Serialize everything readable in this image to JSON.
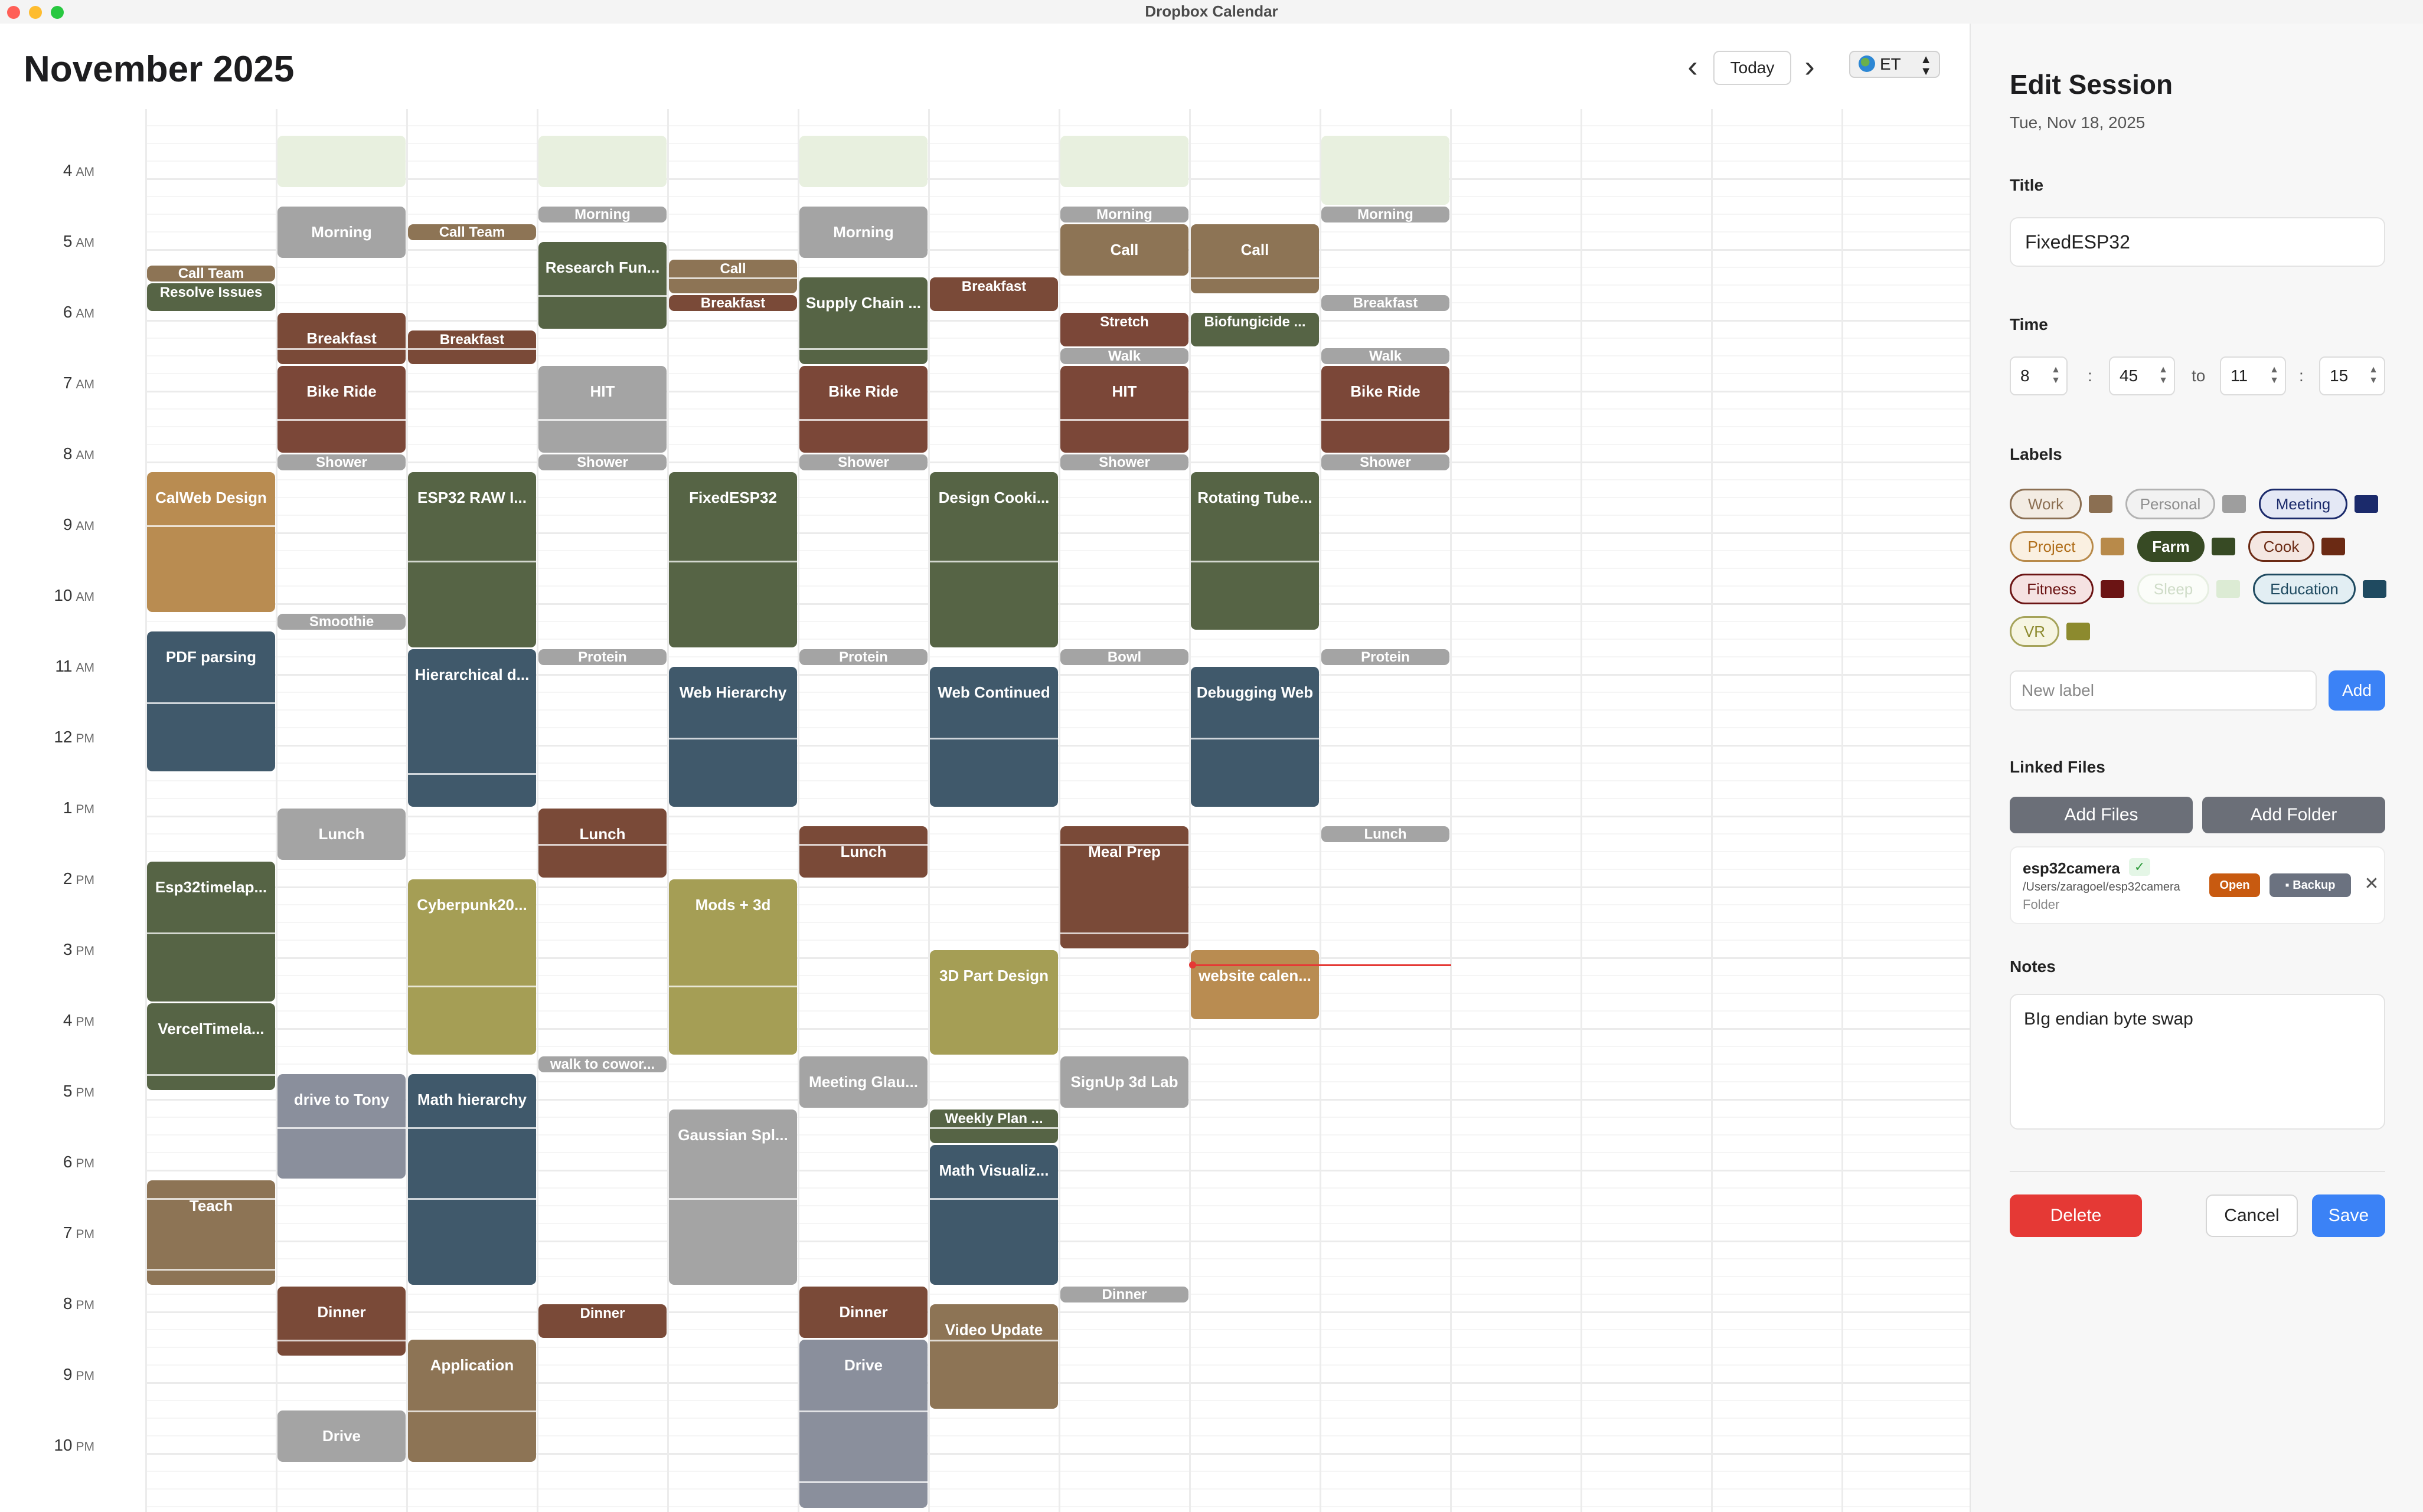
{
  "window": {
    "title": "Dropbox Calendar"
  },
  "header": {
    "month": "November 2025",
    "prev_glyph": "‹",
    "today_label": "Today",
    "next_glyph": "›",
    "timezone": "ET"
  },
  "hours": [
    {
      "h": "4",
      "ampm": "AM"
    },
    {
      "h": "5",
      "ampm": "AM"
    },
    {
      "h": "6",
      "ampm": "AM"
    },
    {
      "h": "7",
      "ampm": "AM"
    },
    {
      "h": "8",
      "ampm": "AM"
    },
    {
      "h": "9",
      "ampm": "AM"
    },
    {
      "h": "10",
      "ampm": "AM"
    },
    {
      "h": "11",
      "ampm": "AM"
    },
    {
      "h": "12",
      "ampm": "PM"
    },
    {
      "h": "1",
      "ampm": "PM"
    },
    {
      "h": "2",
      "ampm": "PM"
    },
    {
      "h": "3",
      "ampm": "PM"
    },
    {
      "h": "4",
      "ampm": "PM"
    },
    {
      "h": "5",
      "ampm": "PM"
    },
    {
      "h": "6",
      "ampm": "PM"
    },
    {
      "h": "7",
      "ampm": "PM"
    },
    {
      "h": "8",
      "ampm": "PM"
    },
    {
      "h": "9",
      "ampm": "PM"
    },
    {
      "h": "10",
      "ampm": "PM"
    }
  ],
  "label_colors": {
    "Work": "#8b6f52",
    "Personal": "#9e9e9e",
    "Meeting": "#1b2a6b",
    "Project": "#b88a4a",
    "Farm": "#374a24",
    "Cook": "#6b2a14",
    "Fitness": "#6b1414",
    "Sleep": "#dcebd4",
    "Education": "#1f4a60",
    "VR": "#8c8a2e"
  },
  "event_colors": {
    "personal": "#a4a4a4",
    "work": "#8d7455",
    "farm": "#566445",
    "cook": "#7a4a38",
    "fitness": "#7b4738",
    "education": "#40596b",
    "project": "#b98c51",
    "vr": "#a59e55",
    "sleep": "#e8f0df",
    "slate": "#8a8f9c"
  },
  "events": [
    {
      "day": 0,
      "start": 5.333,
      "end": 5.583,
      "title": "Call Team",
      "color": "work",
      "segs": []
    },
    {
      "day": 0,
      "start": 5.583,
      "end": 6.0,
      "title": "Resolve Issues",
      "color": "farm",
      "segs": []
    },
    {
      "day": 0,
      "start": 8.25,
      "end": 10.25,
      "title": "CalWeb Design",
      "color": "project",
      "segs": [
        9.0
      ]
    },
    {
      "day": 0,
      "start": 10.5,
      "end": 12.5,
      "title": "PDF parsing",
      "color": "education",
      "segs": [
        11.5
      ]
    },
    {
      "day": 0,
      "start": 13.75,
      "end": 15.75,
      "title": "Esp32timelap...",
      "color": "farm",
      "segs": [
        14.75
      ]
    },
    {
      "day": 0,
      "start": 15.75,
      "end": 17.0,
      "title": "VercelTimela...",
      "color": "farm",
      "segs": [
        16.75
      ]
    },
    {
      "day": 0,
      "start": 18.25,
      "end": 19.75,
      "title": "Teach",
      "color": "work",
      "segs": [
        18.5,
        19.5
      ]
    },
    {
      "day": 1,
      "start": 3.5,
      "end": 4.25,
      "title": "",
      "color": "sleep",
      "segs": []
    },
    {
      "day": 1,
      "start": 4.5,
      "end": 5.25,
      "title": "Morning",
      "color": "personal",
      "segs": []
    },
    {
      "day": 1,
      "start": 6.0,
      "end": 6.75,
      "title": "Breakfast",
      "color": "cook",
      "segs": [
        6.5
      ]
    },
    {
      "day": 1,
      "start": 6.75,
      "end": 8.0,
      "title": "Bike Ride",
      "color": "fitness",
      "segs": [
        7.5
      ]
    },
    {
      "day": 1,
      "start": 8.0,
      "end": 8.25,
      "title": "Shower",
      "color": "personal",
      "segs": []
    },
    {
      "day": 1,
      "start": 10.25,
      "end": 10.5,
      "title": "Smoothie",
      "color": "personal",
      "segs": []
    },
    {
      "day": 1,
      "start": 13.0,
      "end": 13.75,
      "title": "Lunch",
      "color": "personal",
      "segs": []
    },
    {
      "day": 1,
      "start": 16.75,
      "end": 18.25,
      "title": "drive to Tony",
      "color": "slate",
      "segs": [
        17.5
      ]
    },
    {
      "day": 1,
      "start": 19.75,
      "end": 20.75,
      "title": "Dinner",
      "color": "cook",
      "segs": [
        20.5
      ]
    },
    {
      "day": 1,
      "start": 21.5,
      "end": 22.25,
      "title": "Drive",
      "color": "personal",
      "segs": []
    },
    {
      "day": 2,
      "start": 4.75,
      "end": 5.0,
      "title": "Call Team",
      "color": "work",
      "segs": []
    },
    {
      "day": 2,
      "start": 6.25,
      "end": 6.75,
      "title": "Breakfast",
      "color": "cook",
      "segs": [
        6.5
      ]
    },
    {
      "day": 2,
      "start": 8.25,
      "end": 10.75,
      "title": "ESP32 RAW I...",
      "color": "farm",
      "segs": [
        9.5
      ]
    },
    {
      "day": 2,
      "start": 10.75,
      "end": 13.0,
      "title": "Hierarchical d...",
      "color": "education",
      "segs": [
        12.5
      ]
    },
    {
      "day": 2,
      "start": 14.0,
      "end": 16.5,
      "title": "Cyberpunk20...",
      "color": "vr",
      "segs": [
        15.5
      ]
    },
    {
      "day": 2,
      "start": 16.75,
      "end": 19.75,
      "title": "Math hierarchy",
      "color": "education",
      "segs": [
        17.5,
        18.5
      ]
    },
    {
      "day": 2,
      "start": 20.5,
      "end": 22.25,
      "title": "Application",
      "color": "work",
      "segs": [
        21.5
      ]
    },
    {
      "day": 3,
      "start": 3.5,
      "end": 4.25,
      "title": "",
      "color": "sleep",
      "segs": []
    },
    {
      "day": 3,
      "start": 4.5,
      "end": 4.75,
      "title": "Morning",
      "color": "personal",
      "segs": []
    },
    {
      "day": 3,
      "start": 5.0,
      "end": 6.25,
      "title": "Research Fun...",
      "color": "farm",
      "segs": [
        5.75
      ]
    },
    {
      "day": 3,
      "start": 6.75,
      "end": 8.0,
      "title": "HIT",
      "color": "personal",
      "segs": [
        7.5
      ]
    },
    {
      "day": 3,
      "start": 8.0,
      "end": 8.25,
      "title": "Shower",
      "color": "personal",
      "segs": []
    },
    {
      "day": 3,
      "start": 10.75,
      "end": 11.0,
      "title": "Protein",
      "color": "personal",
      "segs": []
    },
    {
      "day": 3,
      "start": 13.0,
      "end": 14.0,
      "title": "Lunch",
      "color": "cook",
      "segs": [
        13.5
      ]
    },
    {
      "day": 3,
      "start": 16.5,
      "end": 16.75,
      "title": "walk to cowor...",
      "color": "personal",
      "segs": []
    },
    {
      "day": 3,
      "start": 20.0,
      "end": 20.5,
      "title": "Dinner",
      "color": "cook",
      "segs": []
    },
    {
      "day": 4,
      "start": 5.25,
      "end": 5.75,
      "title": "Call",
      "color": "work",
      "segs": [
        5.5
      ]
    },
    {
      "day": 4,
      "start": 5.75,
      "end": 6.0,
      "title": "Breakfast",
      "color": "cook",
      "segs": []
    },
    {
      "day": 4,
      "start": 8.25,
      "end": 10.75,
      "title": "FixedESP32",
      "color": "farm",
      "segs": [
        9.5
      ]
    },
    {
      "day": 4,
      "start": 11.0,
      "end": 13.0,
      "title": "Web Hierarchy",
      "color": "education",
      "segs": [
        12.0
      ]
    },
    {
      "day": 4,
      "start": 14.0,
      "end": 16.5,
      "title": "Mods + 3d",
      "color": "vr",
      "segs": [
        15.5
      ]
    },
    {
      "day": 4,
      "start": 17.25,
      "end": 19.75,
      "title": "Gaussian Spl...",
      "color": "personal",
      "segs": [
        18.5
      ]
    },
    {
      "day": 5,
      "start": 3.5,
      "end": 4.25,
      "title": "",
      "color": "sleep",
      "segs": []
    },
    {
      "day": 5,
      "start": 4.5,
      "end": 5.25,
      "title": "Morning",
      "color": "personal",
      "segs": []
    },
    {
      "day": 5,
      "start": 5.5,
      "end": 6.75,
      "title": "Supply Chain ...",
      "color": "farm",
      "segs": [
        6.5
      ]
    },
    {
      "day": 5,
      "start": 6.75,
      "end": 8.0,
      "title": "Bike Ride",
      "color": "fitness",
      "segs": [
        7.5
      ]
    },
    {
      "day": 5,
      "start": 8.0,
      "end": 8.25,
      "title": "Shower",
      "color": "personal",
      "segs": []
    },
    {
      "day": 5,
      "start": 10.75,
      "end": 11.0,
      "title": "Protein",
      "color": "personal",
      "segs": []
    },
    {
      "day": 5,
      "start": 13.25,
      "end": 14.0,
      "title": "Lunch",
      "color": "cook",
      "segs": [
        13.5
      ]
    },
    {
      "day": 5,
      "start": 16.5,
      "end": 17.25,
      "title": "Meeting Glau...",
      "color": "personal",
      "segs": []
    },
    {
      "day": 5,
      "start": 19.75,
      "end": 20.5,
      "title": "Dinner",
      "color": "cook",
      "segs": []
    },
    {
      "day": 5,
      "start": 20.5,
      "end": 22.9,
      "title": "Drive",
      "color": "slate",
      "segs": [
        21.5,
        22.5
      ]
    },
    {
      "day": 6,
      "start": 5.5,
      "end": 6.0,
      "title": "Breakfast",
      "color": "cook",
      "segs": []
    },
    {
      "day": 6,
      "start": 8.25,
      "end": 10.75,
      "title": "Design Cooki...",
      "color": "farm",
      "segs": [
        9.5
      ]
    },
    {
      "day": 6,
      "start": 11.0,
      "end": 13.0,
      "title": "Web Continued",
      "color": "education",
      "segs": [
        12.0
      ]
    },
    {
      "day": 6,
      "start": 15.0,
      "end": 16.5,
      "title": "3D Part Design",
      "color": "vr",
      "segs": []
    },
    {
      "day": 6,
      "start": 17.25,
      "end": 17.75,
      "title": "Weekly Plan ...",
      "color": "farm",
      "segs": [
        17.5
      ]
    },
    {
      "day": 6,
      "start": 17.75,
      "end": 19.75,
      "title": "Math Visualiz...",
      "color": "education",
      "segs": [
        18.5
      ]
    },
    {
      "day": 6,
      "start": 20.0,
      "end": 21.5,
      "title": "Video Update",
      "color": "work",
      "segs": [
        20.5
      ]
    },
    {
      "day": 7,
      "start": 3.5,
      "end": 4.25,
      "title": "",
      "color": "sleep",
      "segs": []
    },
    {
      "day": 7,
      "start": 4.5,
      "end": 4.75,
      "title": "Morning",
      "color": "personal",
      "segs": []
    },
    {
      "day": 7,
      "start": 4.75,
      "end": 5.5,
      "title": "Call",
      "color": "work",
      "segs": []
    },
    {
      "day": 7,
      "start": 6.0,
      "end": 6.5,
      "title": "Stretch",
      "color": "fitness",
      "segs": []
    },
    {
      "day": 7,
      "start": 6.5,
      "end": 6.75,
      "title": "Walk",
      "color": "personal",
      "segs": []
    },
    {
      "day": 7,
      "start": 6.75,
      "end": 8.0,
      "title": "HIT",
      "color": "fitness",
      "segs": [
        7.5
      ]
    },
    {
      "day": 7,
      "start": 8.0,
      "end": 8.25,
      "title": "Shower",
      "color": "personal",
      "segs": []
    },
    {
      "day": 7,
      "start": 10.75,
      "end": 11.0,
      "title": "Bowl",
      "color": "personal",
      "segs": []
    },
    {
      "day": 7,
      "start": 13.25,
      "end": 15.0,
      "title": "Meal Prep",
      "color": "cook",
      "segs": [
        13.5,
        14.75
      ]
    },
    {
      "day": 7,
      "start": 16.5,
      "end": 17.25,
      "title": "SignUp 3d Lab",
      "color": "personal",
      "segs": []
    },
    {
      "day": 7,
      "start": 19.75,
      "end": 20.0,
      "title": "Dinner",
      "color": "personal",
      "segs": []
    },
    {
      "day": 8,
      "start": 4.75,
      "end": 5.75,
      "title": "Call",
      "color": "work",
      "segs": [
        5.5
      ]
    },
    {
      "day": 8,
      "start": 6.0,
      "end": 6.5,
      "title": "Biofungicide ...",
      "color": "farm",
      "segs": []
    },
    {
      "day": 8,
      "start": 8.25,
      "end": 10.5,
      "title": "Rotating Tube...",
      "color": "farm",
      "segs": [
        9.5
      ]
    },
    {
      "day": 8,
      "start": 11.0,
      "end": 13.0,
      "title": "Debugging Web",
      "color": "education",
      "segs": [
        12.0
      ]
    },
    {
      "day": 8,
      "start": 15.0,
      "end": 16.0,
      "title": "website calen...",
      "color": "project",
      "segs": []
    },
    {
      "day": 9,
      "start": 3.5,
      "end": 4.5,
      "title": "",
      "color": "sleep",
      "segs": []
    },
    {
      "day": 9,
      "start": 4.5,
      "end": 4.75,
      "title": "Morning",
      "color": "personal",
      "segs": []
    },
    {
      "day": 9,
      "start": 5.75,
      "end": 6.0,
      "title": "Breakfast",
      "color": "personal",
      "segs": []
    },
    {
      "day": 9,
      "start": 6.5,
      "end": 6.75,
      "title": "Walk",
      "color": "personal",
      "segs": []
    },
    {
      "day": 9,
      "start": 6.75,
      "end": 8.0,
      "title": "Bike Ride",
      "color": "fitness",
      "segs": [
        7.5
      ]
    },
    {
      "day": 9,
      "start": 8.0,
      "end": 8.25,
      "title": "Shower",
      "color": "personal",
      "segs": []
    },
    {
      "day": 9,
      "start": 10.75,
      "end": 11.0,
      "title": "Protein",
      "color": "personal",
      "segs": []
    },
    {
      "day": 9,
      "start": 13.25,
      "end": 13.5,
      "title": "Lunch",
      "color": "personal",
      "segs": []
    }
  ],
  "now": {
    "day_from": 8,
    "day_to": 9,
    "time": 15.2
  },
  "panel": {
    "title": "Edit Session",
    "date": "Tue, Nov 18, 2025",
    "title_section": "Title",
    "title_value": "FixedESP32",
    "time_section": "Time",
    "start_hour": "8",
    "start_min": "45",
    "to_label": "to",
    "end_hour": "11",
    "end_min": "15",
    "colon": ":",
    "labels_section": "Labels",
    "labels": [
      {
        "name": "Work",
        "fg": "#8b6f52",
        "bg": "#f3ece3",
        "border": "#8b6f52",
        "swatch": "#8b6f52",
        "selected": false
      },
      {
        "name": "Personal",
        "fg": "#8e8e8e",
        "bg": "#f2f2f2",
        "border": "#b3b3b3",
        "swatch": "#9e9e9e",
        "selected": false
      },
      {
        "name": "Meeting",
        "fg": "#1b2a6b",
        "bg": "#e4e8f5",
        "border": "#1b2a6b",
        "swatch": "#1b2a6b",
        "selected": false
      },
      {
        "name": "Project",
        "fg": "#b06e1a",
        "bg": "#faf0e1",
        "border": "#b88a4a",
        "swatch": "#b88a4a",
        "selected": false
      },
      {
        "name": "Farm",
        "fg": "#ffffff",
        "bg": "#374a24",
        "border": "#374a24",
        "swatch": "#374a24",
        "selected": true
      },
      {
        "name": "Cook",
        "fg": "#6b2a14",
        "bg": "#f4e7e2",
        "border": "#6b2a14",
        "swatch": "#6b2a14",
        "selected": false
      },
      {
        "name": "Fitness",
        "fg": "#6b1414",
        "bg": "#f5e2e2",
        "border": "#6b1414",
        "swatch": "#6b1414",
        "selected": false
      },
      {
        "name": "Sleep",
        "fg": "#cfdcc8",
        "bg": "#fbfdf9",
        "border": "#e6eee1",
        "swatch": "#dcebd4",
        "selected": false
      },
      {
        "name": "Education",
        "fg": "#1f4a60",
        "bg": "#e2eef3",
        "border": "#1f4a60",
        "swatch": "#1f4a60",
        "selected": false
      },
      {
        "name": "VR",
        "fg": "#8c8a2e",
        "bg": "#f6f5e2",
        "border": "#a5a35a",
        "swatch": "#8c8a2e",
        "selected": false
      }
    ],
    "new_label_placeholder": "New label",
    "add_label": "Add",
    "files_section": "Linked Files",
    "add_files": "Add Files",
    "add_folder": "Add Folder",
    "file": {
      "name": "esp32camera",
      "check": "✓",
      "path": "/Users/zaragoel/esp32camera",
      "type": "Folder",
      "open": "Open",
      "backup": "Backup",
      "remove": "✕"
    },
    "notes_section": "Notes",
    "notes_value": "BIg endian byte swap",
    "delete": "Delete",
    "cancel": "Cancel",
    "save": "Save"
  }
}
